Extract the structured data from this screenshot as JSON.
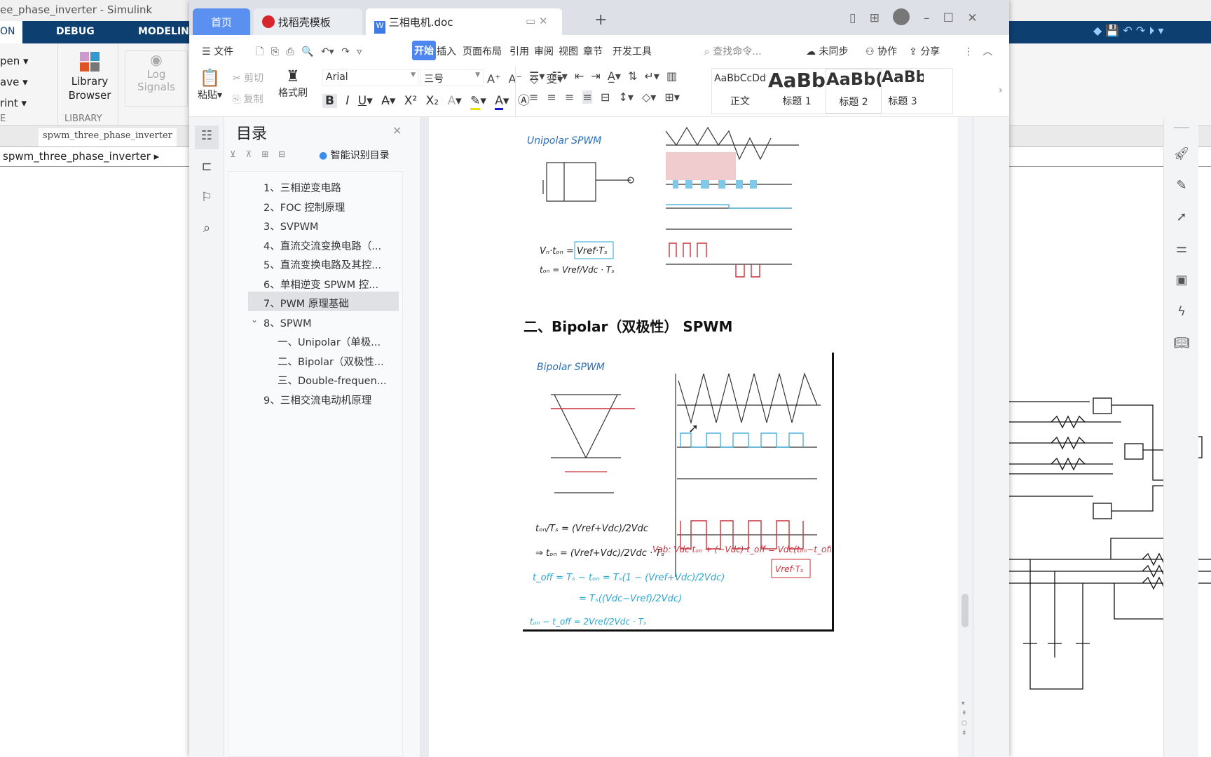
{
  "simulink": {
    "title": "ee_phase_inverter - Simulink",
    "tabs": [
      "ON",
      "DEBUG",
      "MODELING"
    ],
    "file_items": [
      "pen",
      "ave",
      "rint"
    ],
    "file_section": "E",
    "library_browser": "Library\nBrowser",
    "library_section": "LIBRARY",
    "log_signals": "Log\nSignals",
    "address_tab": "spwm_three_phase_inverter",
    "breadcrumb": "spwm_three_phase_inverter"
  },
  "wps": {
    "tabs": [
      {
        "label": "首页"
      },
      {
        "label": "找稻壳模板"
      },
      {
        "label": "三相电机.doc"
      }
    ],
    "menu": {
      "file": "文件",
      "items": [
        "开始",
        "插入",
        "页面布局",
        "引用",
        "审阅",
        "视图",
        "章节",
        "开发工具"
      ],
      "search_placeholder": "查找命令...",
      "unsynced": "未同步",
      "collab": "协作",
      "share": "分享"
    },
    "ribbon": {
      "paste": "粘贴",
      "cut": "剪切",
      "copy": "复制",
      "format_painter": "格式刷",
      "font": "Arial",
      "size": "三号",
      "styles": [
        {
          "preview": "AaBbCcDd",
          "label": "正文"
        },
        {
          "preview": "AaBb",
          "label": "标题 1"
        },
        {
          "preview": "AaBb(",
          "label": "标题 2"
        },
        {
          "preview": "AaBb",
          "label": "标题 3"
        }
      ]
    },
    "toc": {
      "title": "目录",
      "smart": "智能识别目录",
      "items": [
        "1、三相逆变电路",
        "2、FOC 控制原理",
        "3、SVPWM",
        "4、直流交流变换电路（...",
        "5、直流变换电路及其控...",
        "6、单相逆变 SPWM 控...",
        "7、PWM 原理基础",
        "8、SPWM",
        "一、Unipolar（单极...",
        "二、Bipolar（双极性...",
        "三、Double-frequen...",
        "9、三相交流电动机原理"
      ],
      "selected": "7、PWM 原理基础"
    },
    "doc": {
      "heading": "二、Bipolar（双极性） SPWM",
      "fig1_label": "Unipolar SPWM",
      "fig2_label": "Bipolar SPWM"
    }
  },
  "colors": {
    "wps_accent": "#4e86f0",
    "simulink_bar": "#0d3f70"
  }
}
